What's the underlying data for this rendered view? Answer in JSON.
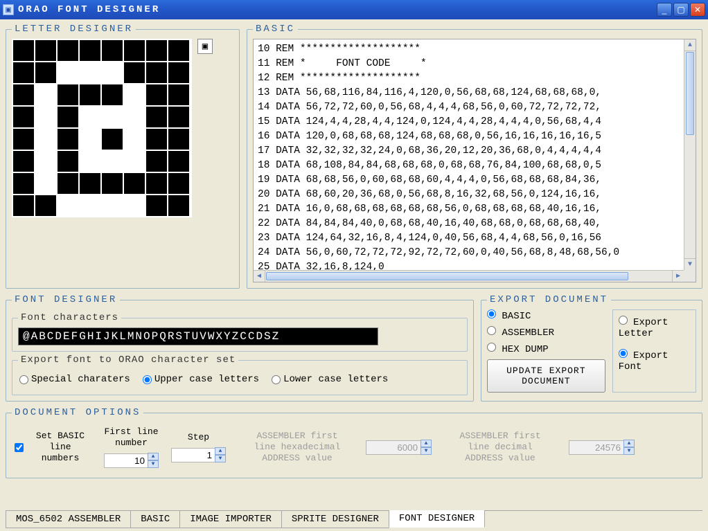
{
  "window": {
    "title": "ORAO  FONT  DESIGNER"
  },
  "letter_designer": {
    "legend": "LETTER DESIGNER",
    "grid": [
      [
        0,
        0,
        0,
        0,
        0,
        0,
        0,
        0
      ],
      [
        0,
        0,
        1,
        1,
        1,
        0,
        0,
        0
      ],
      [
        0,
        1,
        0,
        0,
        0,
        1,
        0,
        0
      ],
      [
        0,
        1,
        0,
        1,
        1,
        1,
        0,
        0
      ],
      [
        0,
        1,
        0,
        1,
        0,
        1,
        0,
        0
      ],
      [
        0,
        1,
        0,
        1,
        1,
        1,
        0,
        0
      ],
      [
        0,
        1,
        0,
        0,
        0,
        0,
        0,
        0
      ],
      [
        0,
        0,
        1,
        1,
        1,
        1,
        0,
        0
      ]
    ]
  },
  "basic": {
    "legend": "BASIC",
    "lines": [
      "10 REM ********************",
      "11 REM *     FONT CODE     *",
      "12 REM ********************",
      "13 DATA 56,68,116,84,116,4,120,0,56,68,68,124,68,68,68,0,",
      "14 DATA 56,72,72,60,0,56,68,4,4,4,68,56,0,60,72,72,72,72,",
      "15 DATA 124,4,4,28,4,4,124,0,124,4,4,28,4,4,4,0,56,68,4,4",
      "16 DATA 120,0,68,68,68,124,68,68,68,0,56,16,16,16,16,16,5",
      "17 DATA 32,32,32,32,24,0,68,36,20,12,20,36,68,0,4,4,4,4,4",
      "18 DATA 68,108,84,84,68,68,68,0,68,68,76,84,100,68,68,0,5",
      "19 DATA 68,68,56,0,60,68,68,60,4,4,4,0,56,68,68,68,84,36,",
      "20 DATA 68,60,20,36,68,0,56,68,8,16,32,68,56,0,124,16,16,",
      "21 DATA 16,0,68,68,68,68,68,68,56,0,68,68,68,68,40,16,16,",
      "22 DATA 84,84,84,40,0,68,68,40,16,40,68,68,0,68,68,68,40,",
      "23 DATA 124,64,32,16,8,4,124,0,40,56,68,4,4,68,56,0,16,56",
      "24 DATA 56,0,60,72,72,72,92,72,72,60,0,40,56,68,8,48,68,56,0",
      "25 DATA 32,16,8,124,0"
    ]
  },
  "font_designer": {
    "legend": "FONT DESIGNER",
    "chars_label": "Font characters",
    "chars_strip": "@ABCDEFGHIJKLMNOPQRSTUVWXYZCCDSZ",
    "export_charset_label": "Export font to ORAO character set",
    "charset_options": {
      "special": "Special charaters",
      "upper": "Upper case letters",
      "lower": "Lower case letters"
    },
    "charset_selected": "upper"
  },
  "export_document": {
    "legend": "EXPORT DOCUMENT",
    "format_options": {
      "basic": "BASIC",
      "assembler": "ASSEMBLER",
      "hex": "HEX DUMP"
    },
    "format_selected": "basic",
    "scope_options": {
      "letter": "Export Letter",
      "font": "Export Font"
    },
    "scope_selected": "font",
    "button": "UPDATE EXPORT DOCUMENT"
  },
  "document_options": {
    "legend": "DOCUMENT OPTIONS",
    "set_basic_label": "Set BASIC line numbers",
    "set_basic_checked": true,
    "first_line_label": "First line number",
    "first_line_value": "10",
    "step_label": "Step",
    "step_value": "1",
    "asm_hex_label": "ASSEMBLER first line hexadecimal ADDRESS value",
    "asm_hex_value": "6000",
    "asm_dec_label": "ASSEMBLER first line decimal ADDRESS value",
    "asm_dec_value": "24576"
  },
  "tabs": {
    "items": [
      "MOS_6502 ASSEMBLER",
      "BASIC",
      "IMAGE IMPORTER",
      "SPRITE DESIGNER",
      "FONT DESIGNER"
    ],
    "active": 4
  }
}
